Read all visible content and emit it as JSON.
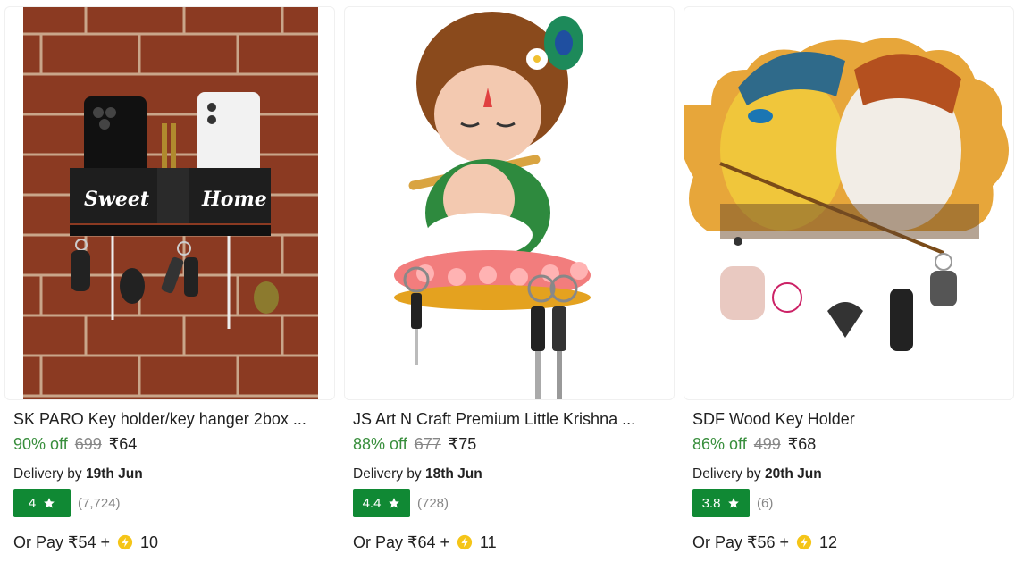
{
  "currency_symbol": "₹",
  "colors": {
    "discount": "#388e3c",
    "rating_badge": "#108934",
    "mrp": "#878787",
    "coin": "#f5c518"
  },
  "products": [
    {
      "title": "SK PARO Key holder/key hanger 2box ...",
      "discount": "90% off",
      "mrp": "699",
      "price": "₹64",
      "delivery_prefix": "Delivery by",
      "delivery_date": "19th Jun",
      "rating": "4",
      "rating_count": "(7,724)",
      "pay_prefix": "Or Pay ₹54 +",
      "coins": "10",
      "image_icon": "sweet-home-key-holder-image"
    },
    {
      "title": "JS Art N Craft Premium Little Krishna ...",
      "discount": "88% off",
      "mrp": "677",
      "price": "₹75",
      "delivery_prefix": "Delivery by",
      "delivery_date": "18th Jun",
      "rating": "4.4",
      "rating_count": "(728)",
      "pay_prefix": "Or Pay ₹64 +",
      "coins": "11",
      "image_icon": "little-krishna-key-holder-image"
    },
    {
      "title": "SDF Wood Key Holder",
      "discount": "86% off",
      "mrp": "499",
      "price": "₹68",
      "delivery_prefix": "Delivery by",
      "delivery_date": "20th Jun",
      "rating": "3.8",
      "rating_count": "(6)",
      "pay_prefix": "Or Pay ₹56 +",
      "coins": "12",
      "image_icon": "radha-krishna-key-holder-image"
    }
  ]
}
